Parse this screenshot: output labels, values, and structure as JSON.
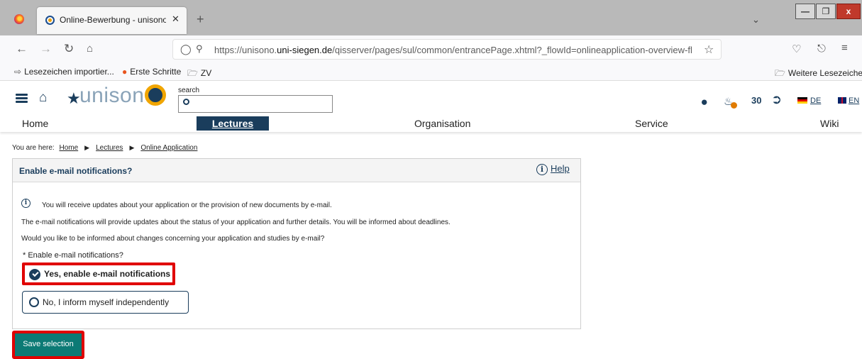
{
  "browser": {
    "tab_title": "Online-Bewerbung - unisono - ...",
    "tab_close": "✕",
    "new_tab": "+",
    "url_host": "https://unisono.",
    "url_domain": "uni-siegen.de",
    "url_path": "/qisserver/pages/sul/common/entrancePage.xhtml?_flowId=onlineapplication-overview-fl",
    "window_min": "—",
    "window_max": "❐",
    "window_close": "x"
  },
  "bookmarks": {
    "items": [
      {
        "label": "Lesezeichen importier..."
      },
      {
        "label": "Erste Schritte"
      },
      {
        "label": "ZV"
      }
    ],
    "other": "Weitere Lesezeichen"
  },
  "header": {
    "logo_text": "unison",
    "search_label": "search",
    "search_value": "",
    "session_timer": "30",
    "lang_de": "DE",
    "lang_en": "EN"
  },
  "menu": {
    "items": [
      {
        "label": "Home"
      },
      {
        "label": "Lectures"
      },
      {
        "label": "Organisation"
      },
      {
        "label": "Service"
      },
      {
        "label": "Wiki"
      }
    ]
  },
  "breadcrumb": {
    "prefix": "You are here:",
    "items": [
      {
        "label": "Home"
      },
      {
        "label": "Lectures"
      },
      {
        "label": "Online Application"
      }
    ]
  },
  "panel": {
    "title": "Enable e-mail notifications?",
    "help_label": "Help",
    "info_line": "You will receive updates about your application or the provision of new documents by e-mail.",
    "line2": "The e-mail notifications will provide updates about the status of your application and further details. You will be informed about deadlines.",
    "line3": "Would you like to be informed about changes concerning your application and studies by e-mail?",
    "field_label": "* Enable e-mail notifications?",
    "options": [
      {
        "label": "Yes, enable e-mail notifications",
        "selected": true
      },
      {
        "label": "No, I inform myself independently",
        "selected": false
      }
    ]
  },
  "actions": {
    "save_label": "Save selection"
  },
  "colors": {
    "brand_dark": "#1a3d5c",
    "brand_accent": "#f0a500",
    "button_teal": "#0c7a75",
    "highlight_red": "#e00000"
  }
}
